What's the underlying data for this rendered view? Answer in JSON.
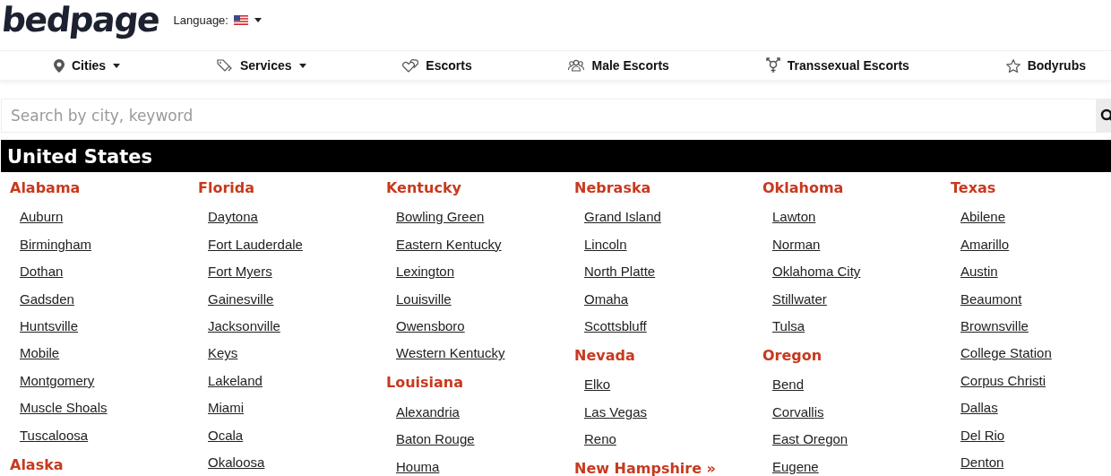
{
  "logo": "bedpage",
  "language": {
    "label": "Language:"
  },
  "nav": [
    {
      "label": "Cities",
      "kind": "pin",
      "dropdown": true
    },
    {
      "label": "Services",
      "kind": "tags",
      "dropdown": true
    },
    {
      "label": "Escorts",
      "kind": "hearts",
      "dropdown": false
    },
    {
      "label": "Male Escorts",
      "kind": "group",
      "dropdown": false
    },
    {
      "label": "Transsexual Escorts",
      "kind": "gender",
      "dropdown": false
    },
    {
      "label": "Bodyrubs",
      "kind": "star",
      "dropdown": false
    }
  ],
  "search": {
    "placeholder": "Search by city, keyword"
  },
  "section_title": "United States",
  "columns": [
    [
      {
        "kind": "state",
        "text": "Alabama"
      },
      {
        "kind": "city",
        "text": "Auburn"
      },
      {
        "kind": "city",
        "text": "Birmingham"
      },
      {
        "kind": "city",
        "text": "Dothan"
      },
      {
        "kind": "city",
        "text": "Gadsden"
      },
      {
        "kind": "city",
        "text": "Huntsville"
      },
      {
        "kind": "city",
        "text": "Mobile"
      },
      {
        "kind": "city",
        "text": "Montgomery"
      },
      {
        "kind": "city",
        "text": "Muscle Shoals"
      },
      {
        "kind": "city",
        "text": "Tuscaloosa"
      },
      {
        "kind": "state",
        "text": "Alaska"
      }
    ],
    [
      {
        "kind": "state",
        "text": "Florida"
      },
      {
        "kind": "city",
        "text": "Daytona"
      },
      {
        "kind": "city",
        "text": "Fort Lauderdale"
      },
      {
        "kind": "city",
        "text": "Fort Myers"
      },
      {
        "kind": "city",
        "text": "Gainesville"
      },
      {
        "kind": "city",
        "text": "Jacksonville"
      },
      {
        "kind": "city",
        "text": "Keys"
      },
      {
        "kind": "city",
        "text": "Lakeland"
      },
      {
        "kind": "city",
        "text": "Miami"
      },
      {
        "kind": "city",
        "text": "Ocala"
      },
      {
        "kind": "city",
        "text": "Okaloosa"
      }
    ],
    [
      {
        "kind": "state",
        "text": "Kentucky"
      },
      {
        "kind": "city",
        "text": "Bowling Green"
      },
      {
        "kind": "city",
        "text": "Eastern Kentucky"
      },
      {
        "kind": "city",
        "text": "Lexington"
      },
      {
        "kind": "city",
        "text": "Louisville"
      },
      {
        "kind": "city",
        "text": "Owensboro"
      },
      {
        "kind": "city",
        "text": "Western Kentucky"
      },
      {
        "kind": "state",
        "text": "Louisiana"
      },
      {
        "kind": "city",
        "text": "Alexandria"
      },
      {
        "kind": "city",
        "text": "Baton Rouge"
      },
      {
        "kind": "city",
        "text": "Houma"
      }
    ],
    [
      {
        "kind": "state",
        "text": "Nebraska"
      },
      {
        "kind": "city",
        "text": "Grand Island"
      },
      {
        "kind": "city",
        "text": "Lincoln"
      },
      {
        "kind": "city",
        "text": "North Platte"
      },
      {
        "kind": "city",
        "text": "Omaha"
      },
      {
        "kind": "city",
        "text": "Scottsbluff"
      },
      {
        "kind": "state",
        "text": "Nevada"
      },
      {
        "kind": "city",
        "text": "Elko"
      },
      {
        "kind": "city",
        "text": "Las Vegas"
      },
      {
        "kind": "city",
        "text": "Reno"
      },
      {
        "kind": "state",
        "text": "New Hampshire »"
      }
    ],
    [
      {
        "kind": "state",
        "text": "Oklahoma"
      },
      {
        "kind": "city",
        "text": "Lawton"
      },
      {
        "kind": "city",
        "text": "Norman"
      },
      {
        "kind": "city",
        "text": "Oklahoma City"
      },
      {
        "kind": "city",
        "text": "Stillwater"
      },
      {
        "kind": "city",
        "text": "Tulsa"
      },
      {
        "kind": "state",
        "text": "Oregon"
      },
      {
        "kind": "city",
        "text": "Bend"
      },
      {
        "kind": "city",
        "text": "Corvallis"
      },
      {
        "kind": "city",
        "text": "East Oregon"
      },
      {
        "kind": "city",
        "text": "Eugene"
      }
    ],
    [
      {
        "kind": "state",
        "text": "Texas"
      },
      {
        "kind": "city",
        "text": "Abilene"
      },
      {
        "kind": "city",
        "text": "Amarillo"
      },
      {
        "kind": "city",
        "text": "Austin"
      },
      {
        "kind": "city",
        "text": "Beaumont"
      },
      {
        "kind": "city",
        "text": "Brownsville"
      },
      {
        "kind": "city",
        "text": "College Station"
      },
      {
        "kind": "city",
        "text": "Corpus Christi"
      },
      {
        "kind": "city",
        "text": "Dallas"
      },
      {
        "kind": "city",
        "text": "Del Rio"
      },
      {
        "kind": "city",
        "text": "Denton"
      }
    ]
  ]
}
